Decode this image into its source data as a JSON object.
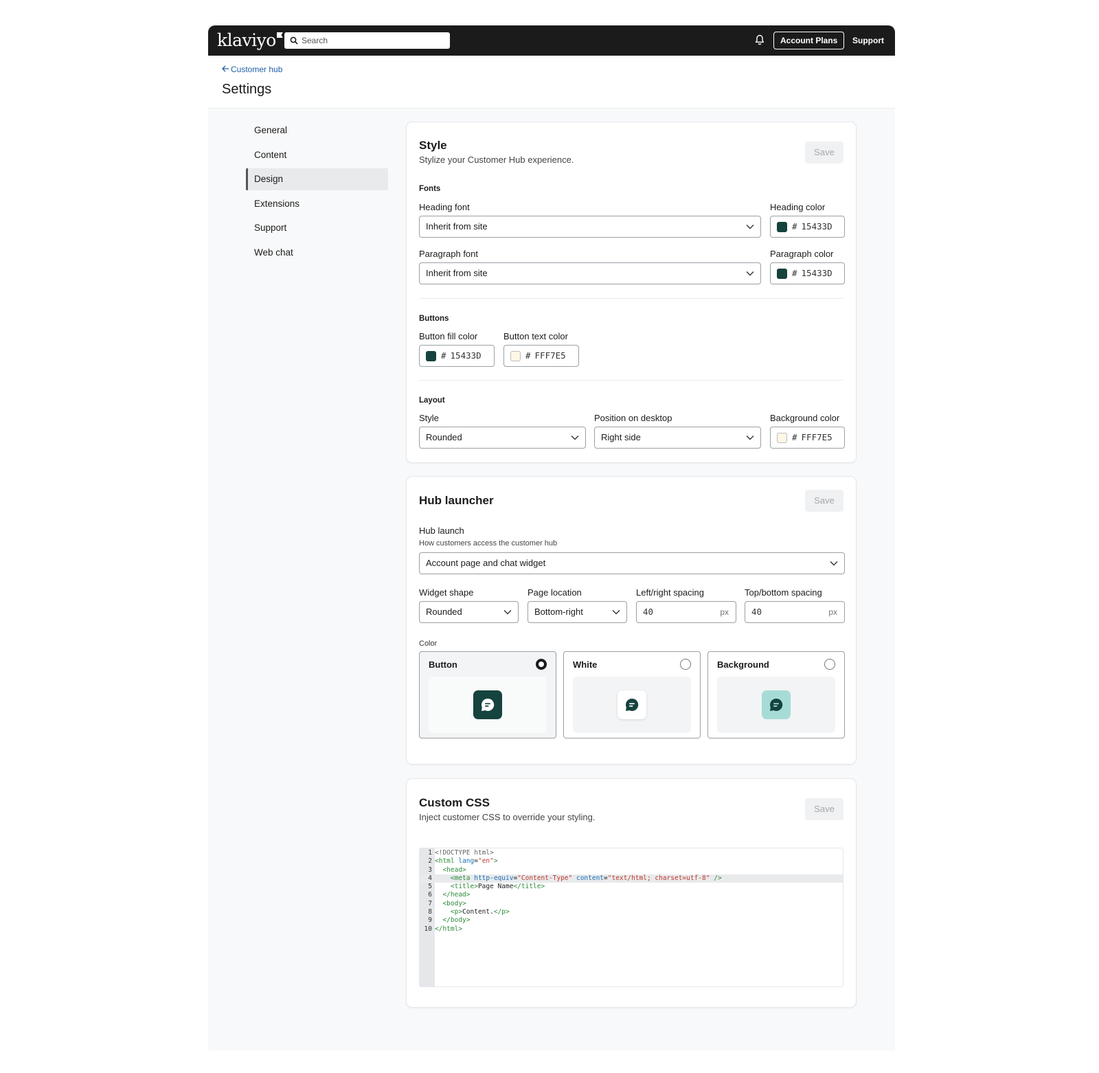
{
  "topbar": {
    "logo": "klaviyo",
    "search_placeholder": "Search",
    "account_plans": "Account Plans",
    "support": "Support"
  },
  "header": {
    "breadcrumb": "Customer hub",
    "title": "Settings"
  },
  "nav": {
    "items": [
      "General",
      "Content",
      "Design",
      "Extensions",
      "Support",
      "Web chat"
    ],
    "active": "Design"
  },
  "style_card": {
    "title": "Style",
    "subtitle": "Stylize your Customer Hub experience.",
    "save": "Save",
    "fonts": {
      "section": "Fonts",
      "heading_font_label": "Heading font",
      "heading_font_value": "Inherit from site",
      "heading_color_label": "Heading color",
      "heading_color_value": "15433D",
      "paragraph_font_label": "Paragraph font",
      "paragraph_font_value": "Inherit from site",
      "paragraph_color_label": "Paragraph color",
      "paragraph_color_value": "15433D"
    },
    "buttons": {
      "section": "Buttons",
      "fill_label": "Button fill color",
      "fill_value": "15433D",
      "text_label": "Button text color",
      "text_value": "FFF7E5"
    },
    "layout": {
      "section": "Layout",
      "style_label": "Style",
      "style_value": "Rounded",
      "position_label": "Position on desktop",
      "position_value": "Right side",
      "bg_label": "Background color",
      "bg_value": "FFF7E5"
    }
  },
  "hub_card": {
    "title": "Hub launcher",
    "save": "Save",
    "launch_label": "Hub launch",
    "launch_hint": "How customers access the customer hub",
    "launch_value": "Account page and chat widget",
    "widget_shape_label": "Widget shape",
    "widget_shape_value": "Rounded",
    "page_location_label": "Page location",
    "page_location_value": "Bottom-right",
    "lr_spacing_label": "Left/right spacing",
    "lr_spacing_value": "40",
    "tb_spacing_label": "Top/bottom spacing",
    "tb_spacing_value": "40",
    "unit": "px",
    "color_label": "Color",
    "color_options": [
      "Button",
      "White",
      "Background"
    ],
    "selected_color": "Button"
  },
  "css_card": {
    "title": "Custom CSS",
    "subtitle": "Inject customer CSS to override your styling.",
    "save": "Save",
    "code_lines": [
      "<!DOCTYPE html>",
      "<html lang=\"en\">",
      "  <head>",
      "    <meta http-equiv=\"Content-Type\" content=\"text/html; charset=utf-8\" />",
      "    <title>Page Name</title>",
      "  </head>",
      "  <body>",
      "    <p>Content.</p>",
      "  </body>",
      "</html>"
    ],
    "highlighted_line": 4
  },
  "colors": {
    "dark_green": "#15433D",
    "cream": "#FFF7E5",
    "mint": "#A7DCD6",
    "link": "#1F5FA8"
  }
}
